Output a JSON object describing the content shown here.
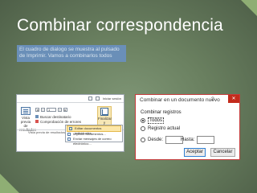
{
  "slide": {
    "title": "Combinar correspondencia",
    "caption": "El cuadro de dialogo se muestra al pulsado de Imprimir. Vamos a combinarlos todos"
  },
  "ribbon": {
    "top_label": "Iniciar sesión",
    "vista_label": "Vista previa de resultados",
    "nav_value": "1",
    "list_items": [
      "Buscar destinatario",
      "Comprobación de errores"
    ],
    "group_label": "Vista previa de resultados",
    "finalizar_label": "Finalizar y combinar",
    "menu_items": [
      "Editar documentos individuales...",
      "Imprimir documentos...",
      "Enviar mensajes de correo electrónico..."
    ]
  },
  "dialog": {
    "title": "Combinar en un documento nuevo",
    "help": "?",
    "close": "✕",
    "group_label": "Combinar registros",
    "options": [
      "Todos",
      "Registro actual"
    ],
    "desde_label": "Desde:",
    "hasta_label": "Hasta:",
    "ok_label": "Aceptar",
    "cancel_label": "Cancelar",
    "selected": "Todos"
  },
  "colors": {
    "background": "#6a8060",
    "accent": "#8fae74",
    "caption_bg": "#6a8fb8",
    "close_red": "#c42b1c"
  }
}
